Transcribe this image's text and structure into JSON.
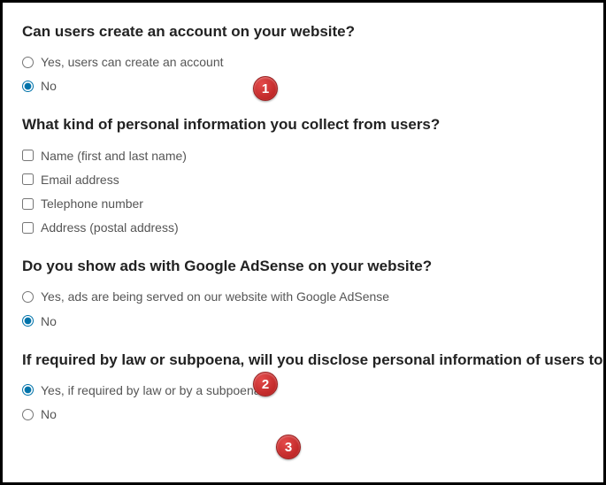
{
  "questions": [
    {
      "title": "Can users create an account on your website?",
      "type": "radio",
      "options": [
        {
          "label": "Yes, users can create an account",
          "checked": false
        },
        {
          "label": "No",
          "checked": true
        }
      ]
    },
    {
      "title": "What kind of personal information you collect from users?",
      "type": "checkbox",
      "options": [
        {
          "label": "Name (first and last name)",
          "checked": false
        },
        {
          "label": "Email address",
          "checked": false
        },
        {
          "label": "Telephone number",
          "checked": false
        },
        {
          "label": "Address (postal address)",
          "checked": false
        }
      ]
    },
    {
      "title": "Do you show ads with Google AdSense on your website?",
      "type": "radio",
      "options": [
        {
          "label": "Yes, ads are being served on our website with Google AdSense",
          "checked": false
        },
        {
          "label": "No",
          "checked": true
        }
      ]
    },
    {
      "title": "If required by law or subpoena, will you disclose personal information of users to",
      "type": "radio",
      "options": [
        {
          "label": "Yes, if required by law or by a subpoena",
          "checked": true
        },
        {
          "label": "No",
          "checked": false
        }
      ]
    }
  ],
  "badges": {
    "b1": "1",
    "b2": "2",
    "b3": "3"
  }
}
